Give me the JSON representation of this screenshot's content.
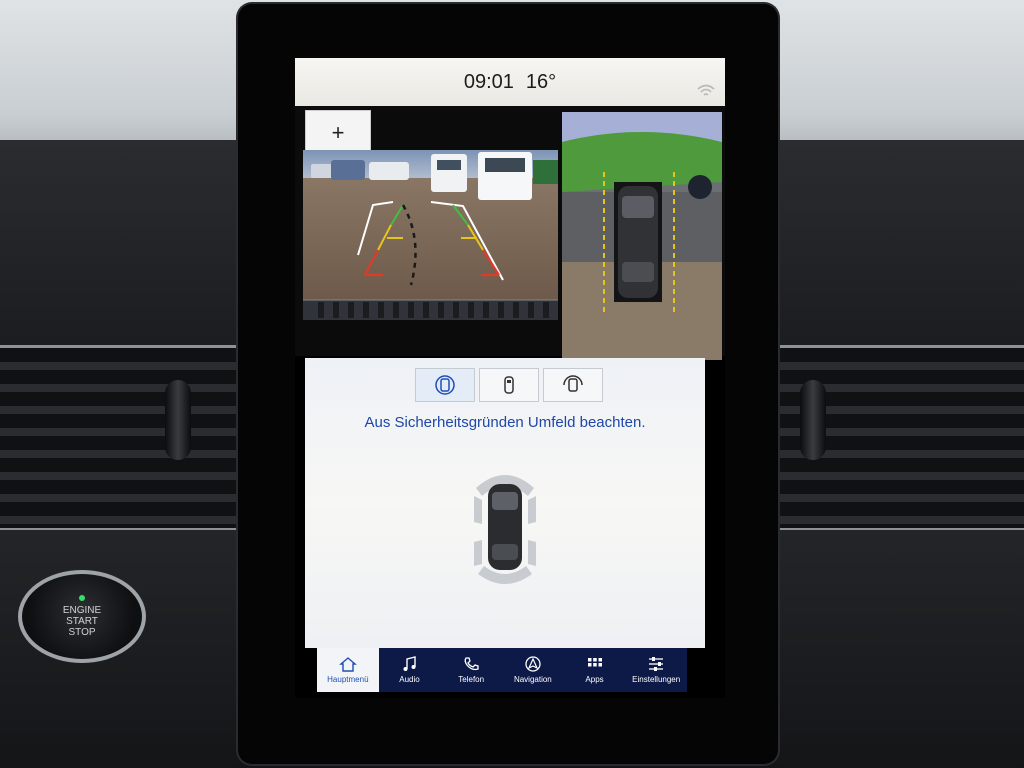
{
  "status": {
    "time": "09:01",
    "temperature": "16°",
    "wifi_icon": "wifi-icon"
  },
  "camera": {
    "add_button": "+",
    "add_icon": "plus-icon"
  },
  "view_buttons": [
    {
      "icon": "rear-camera-view-icon",
      "selected": true
    },
    {
      "icon": "top-view-icon",
      "selected": false
    },
    {
      "icon": "front-camera-view-icon",
      "selected": false
    }
  ],
  "panel": {
    "warning": "Aus Sicherheitsgründen Umfeld beachten."
  },
  "nav": {
    "items": [
      {
        "label": "Hauptmenü",
        "icon": "home-icon",
        "active": true
      },
      {
        "label": "Audio",
        "icon": "music-note-icon",
        "active": false
      },
      {
        "label": "Telefon",
        "icon": "phone-icon",
        "active": false
      },
      {
        "label": "Navigation",
        "icon": "navigation-icon",
        "active": false
      },
      {
        "label": "Apps",
        "icon": "apps-grid-icon",
        "active": false
      },
      {
        "label": "Einstellungen",
        "icon": "settings-sliders-icon",
        "active": false
      }
    ]
  },
  "button": {
    "engine_line1": "ENGINE",
    "engine_line2": "START",
    "engine_line3": "STOP"
  },
  "colors": {
    "nav_bg": "#0d1a48",
    "accent_blue": "#1e47a8",
    "guide_green": "#3fbf3f",
    "guide_yellow": "#e3c51b",
    "guide_red": "#e03a2a"
  }
}
